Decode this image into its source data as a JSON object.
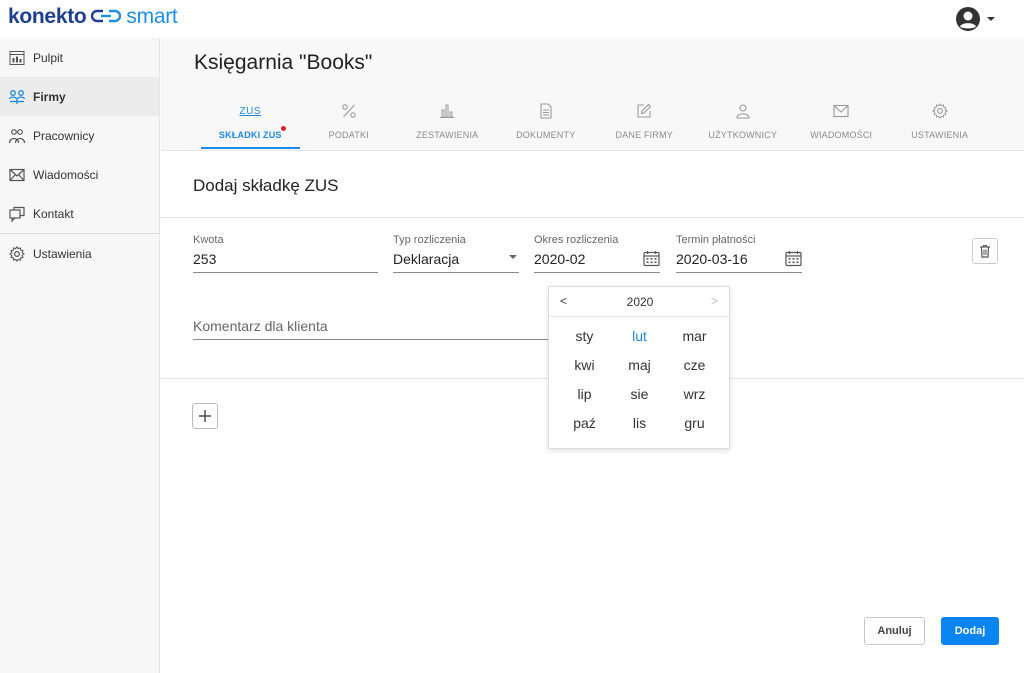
{
  "brand": {
    "name_part1": "konekto",
    "name_part2": "smart",
    "color_primary": "#1d3f8f",
    "color_accent": "#1e8fe6"
  },
  "user_menu": {
    "icon": "user-circle-icon"
  },
  "sidebar": {
    "items": [
      {
        "label": "Pulpit",
        "icon": "dashboard-icon"
      },
      {
        "label": "Firmy",
        "icon": "companies-icon",
        "active": true
      },
      {
        "label": "Pracownicy",
        "icon": "employees-icon"
      },
      {
        "label": "Wiadomości",
        "icon": "envelope-icon"
      },
      {
        "label": "Kontakt",
        "icon": "chat-icon"
      },
      {
        "label": "Ustawienia",
        "icon": "gear-icon"
      }
    ]
  },
  "page": {
    "title": "Księgarnia \"Books\""
  },
  "tabs": [
    {
      "label": "SKŁADKI ZUS",
      "icon_text": "ZUS",
      "active": true,
      "has_alert": true
    },
    {
      "label": "PODATKI",
      "icon": "percent-icon"
    },
    {
      "label": "ZESTAWIENIA",
      "icon": "bar-chart-icon"
    },
    {
      "label": "DOKUMENTY",
      "icon": "document-icon"
    },
    {
      "label": "DANE FIRMY",
      "icon": "edit-icon"
    },
    {
      "label": "UŻYTKOWNICY",
      "icon": "users-icon"
    },
    {
      "label": "WIADOMOŚCI",
      "icon": "envelope-icon"
    },
    {
      "label": "USTAWIENIA",
      "icon": "gear-icon"
    }
  ],
  "form": {
    "title": "Dodaj składkę ZUS",
    "kwota": {
      "label": "Kwota",
      "value": "253"
    },
    "typ": {
      "label": "Typ rozliczenia",
      "value": "Deklaracja"
    },
    "okres": {
      "label": "Okres rozliczenia",
      "value": "2020-02"
    },
    "termin": {
      "label": "Termin płatności",
      "value": "2020-03-16"
    },
    "comment": {
      "placeholder": "Komentarz dla klienta"
    }
  },
  "picker": {
    "prev": "<",
    "next": ">",
    "year": "2020",
    "months": [
      "sty",
      "lut",
      "mar",
      "kwi",
      "maj",
      "cze",
      "lip",
      "sie",
      "wrz",
      "paź",
      "lis",
      "gru"
    ],
    "selected_index": 1
  },
  "actions": {
    "cancel": "Anuluj",
    "submit": "Dodaj"
  }
}
